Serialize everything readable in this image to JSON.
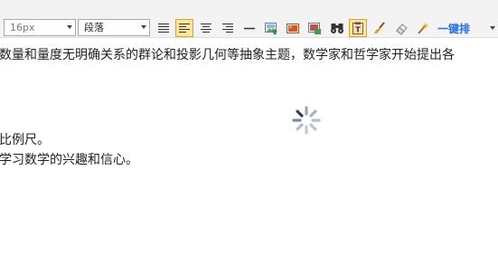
{
  "toolbar": {
    "font_size": {
      "value": "16px",
      "icon": "dropdown-arrow"
    },
    "paragraph": {
      "value": "段落",
      "icon": "dropdown-arrow"
    },
    "buttons": [
      {
        "name": "justify-full",
        "icon": "align-justify-icon",
        "active": false
      },
      {
        "name": "align-left",
        "icon": "align-left-icon",
        "active": true
      },
      {
        "name": "align-center",
        "icon": "align-center-icon",
        "active": false
      },
      {
        "name": "align-right",
        "icon": "align-right-icon",
        "active": false
      },
      {
        "name": "horizontal-rule",
        "icon": "horizontal-rule-icon",
        "active": false
      },
      {
        "name": "insert-image",
        "icon": "image-upload-icon",
        "active": false
      },
      {
        "name": "insert-picture",
        "icon": "picture-icon",
        "active": false
      },
      {
        "name": "insert-gallery",
        "icon": "gallery-icon",
        "active": false
      },
      {
        "name": "find",
        "icon": "binoculars-icon",
        "active": false
      },
      {
        "name": "paste-plain",
        "icon": "paste-text-icon",
        "active": true
      },
      {
        "name": "format-brush",
        "icon": "brush-icon",
        "active": false
      },
      {
        "name": "eraser",
        "icon": "eraser-icon",
        "active": false
      },
      {
        "name": "auto-format",
        "icon": "magic-wand-icon",
        "active": false
      }
    ],
    "typeset_label": "一键排"
  },
  "content": {
    "lines": [
      "数量和量度无明确关系的群论和投影几何等抽象主题，数学家和哲学家开始提出各",
      "比例尺。",
      "学习数学的兴趣和信心。"
    ],
    "loading_indicator": "spinner-icon"
  },
  "colors": {
    "toolbar_bg": "#f3f3f3",
    "active_bg": "#ffe6a0",
    "typeset_text": "#2a6fd6",
    "spinner": "#8a9aaa"
  }
}
